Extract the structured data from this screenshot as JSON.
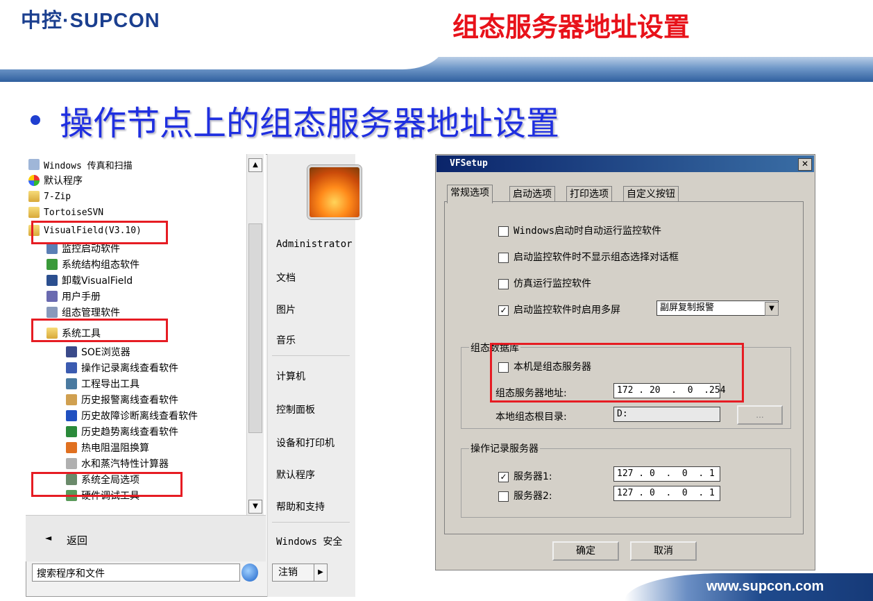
{
  "header": {
    "logo": "中控·SUPCON",
    "title": "组态服务器地址设置"
  },
  "bullet": "操作节点上的组态服务器地址设置",
  "start_menu": {
    "programs": [
      {
        "label": "Windows 传真和扫描",
        "icon": "fax-icon"
      },
      {
        "label": "默认程序",
        "icon": "default-programs-icon"
      },
      {
        "label": "7-Zip",
        "icon": "folder-icon"
      },
      {
        "label": "TortoiseSVN",
        "icon": "folder-icon"
      },
      {
        "label": "VisualField(V3.10)",
        "icon": "folder-icon"
      },
      {
        "label": "监控启动软件",
        "icon": "monitor-icon"
      },
      {
        "label": "系统结构组态软件",
        "icon": "structure-icon"
      },
      {
        "label": "卸载VisualField",
        "icon": "uninstall-icon"
      },
      {
        "label": "用户手册",
        "icon": "manual-icon"
      },
      {
        "label": "组态管理软件",
        "icon": "config-icon"
      },
      {
        "label": "系统工具",
        "icon": "folder-icon"
      },
      {
        "label": "SOE浏览器",
        "icon": "soe-icon"
      },
      {
        "label": "操作记录离线查看软件",
        "icon": "record-icon"
      },
      {
        "label": "工程导出工具",
        "icon": "export-icon"
      },
      {
        "label": "历史报警离线查看软件",
        "icon": "alarm-icon"
      },
      {
        "label": "历史故障诊断离线查看软件",
        "icon": "diagnosis-icon"
      },
      {
        "label": "历史趋势离线查看软件",
        "icon": "trend-icon"
      },
      {
        "label": "热电阻温阻换算",
        "icon": "thermo-icon"
      },
      {
        "label": "水和蒸汽特性计算器",
        "icon": "steam-icon"
      },
      {
        "label": "系统全局选项",
        "icon": "global-options-icon"
      },
      {
        "label": "硬件调试工具",
        "icon": "hardware-icon"
      }
    ],
    "back_label": "返回",
    "search_placeholder": "搜索程序和文件",
    "right_items": [
      "Administrator",
      "文档",
      "图片",
      "音乐",
      "计算机",
      "控制面板",
      "设备和打印机",
      "默认程序",
      "帮助和支持",
      "Windows 安全"
    ],
    "logoff_label": "注销"
  },
  "dialog": {
    "title": "VFSetup",
    "tabs": [
      "常规选项",
      "启动选项",
      "打印选项",
      "自定义按钮"
    ],
    "options": [
      {
        "label": "Windows启动时自动运行监控软件",
        "checked": false
      },
      {
        "label": "启动监控软件时不显示组态选择对话框",
        "checked": false
      },
      {
        "label": "仿真运行监控软件",
        "checked": false
      },
      {
        "label": "启动监控软件时启用多屏",
        "checked": true
      }
    ],
    "multiscreen_select": "副屏复制报警",
    "config_db": {
      "title": "组态数据库",
      "is_server_label": "本机是组态服务器",
      "is_server_checked": false,
      "server_addr_label": "组态服务器地址:",
      "server_addr": "172 . 20  .  0  .254",
      "root_dir_label": "本地组态根目录:",
      "root_dir": "D:",
      "browse_label": "..."
    },
    "record_server": {
      "title": "操作记录服务器",
      "server1_label": "服务器1:",
      "server1_checked": true,
      "server1_addr": "127 . 0  .  0  . 1",
      "server2_label": "服务器2:",
      "server2_checked": false,
      "server2_addr": "127 . 0  .  0  . 1"
    },
    "ok_label": "确定",
    "cancel_label": "取消"
  },
  "footer": {
    "url": "www.supcon.com"
  },
  "colors": {
    "title_red": "#e8121a",
    "bullet_blue": "#1f2fe0",
    "highlight_red": "#e61c23",
    "logo_blue": "#1b3f8f"
  }
}
